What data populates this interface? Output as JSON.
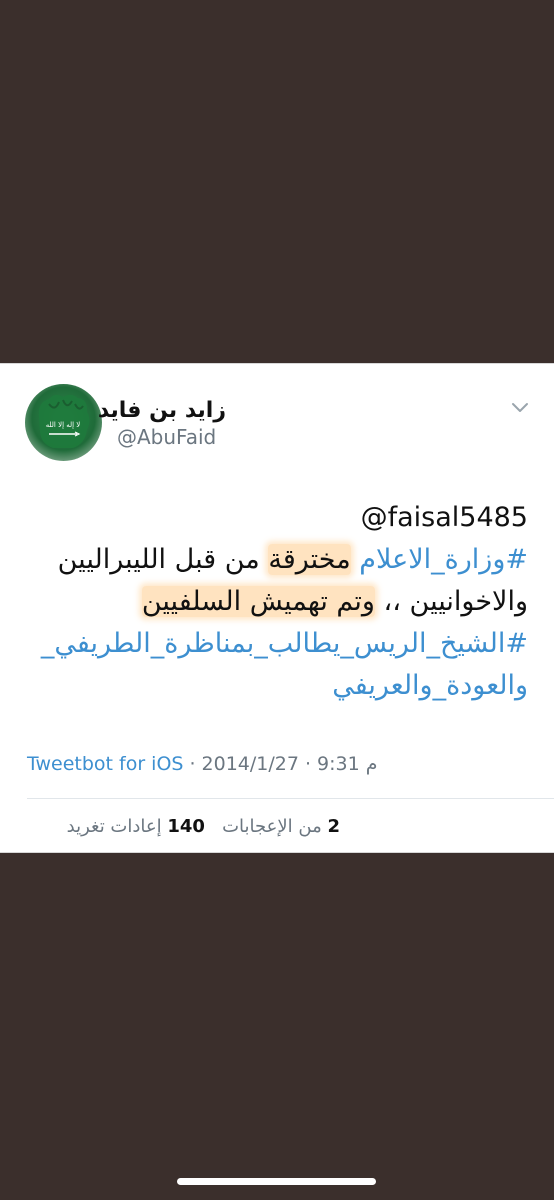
{
  "tweet": {
    "display_name": "زايد بن فايد",
    "username": "@AbuFaid",
    "avatar_icon": "saudi-flag-fist-icon",
    "text": {
      "mention": "faisal5485@",
      "hashtag_ministry": "#وزارة_الاعلام",
      "word_infiltrated": "مخترقة",
      "rest_line2": "من قبل الليبراليين",
      "line3_start": "والاخوانيين ،،",
      "line3_highlight": "وتم تهميش السلفيين",
      "hashtag_sheikh_line1": "#الشيخ_الريس_يطالب_بمناظرة_الطريفي_",
      "hashtag_sheikh_line2": "والعودة_والعريفي"
    },
    "meta": {
      "time": "9:31 م",
      "sep1": "·",
      "date": "2014/1/27",
      "sep2": "·",
      "source": "Tweetbot for iOS"
    },
    "stats": {
      "likes_count": "2",
      "likes_label": "من الإعجابات",
      "retweets_count": "140",
      "retweets_label": "إعادات تغريد"
    }
  },
  "colors": {
    "background": "#3b2f2c",
    "link": "#3d8fd0",
    "highlight": "#ffcc8c"
  }
}
